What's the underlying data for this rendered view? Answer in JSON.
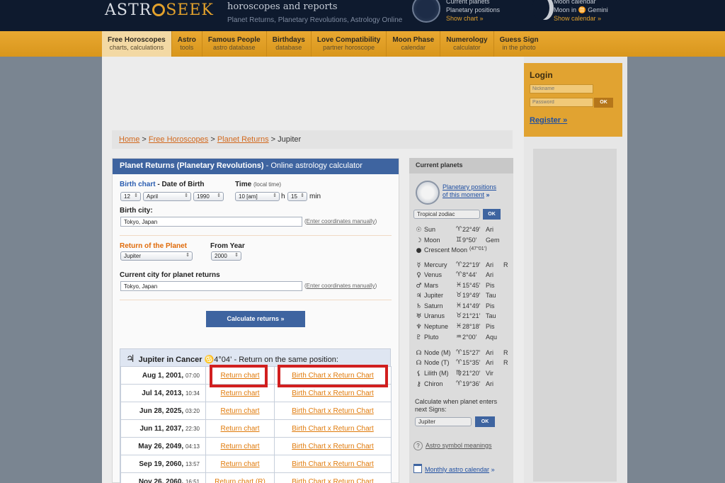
{
  "header": {
    "logo_left": "ASTR",
    "logo_right": "SEEK",
    "title": "horoscopes and reports",
    "subtitle": "Planet Returns, Planetary Revolutions, Astrology Online",
    "planets_title": "Current planets",
    "planets_sub": "Planetary positions",
    "planets_link": "Show chart »",
    "moon_title": "Moon calendar",
    "moon_sub": "Moon in ♊ Gemini",
    "moon_link": "Show calendar »"
  },
  "nav": [
    {
      "title": "Free Horoscopes",
      "sub": "charts, calculations"
    },
    {
      "title": "Astro",
      "sub": "tools"
    },
    {
      "title": "Famous People",
      "sub": "astro database"
    },
    {
      "title": "Birthdays",
      "sub": "database"
    },
    {
      "title": "Love Compatibility",
      "sub": "partner horoscope"
    },
    {
      "title": "Moon Phase",
      "sub": "calendar"
    },
    {
      "title": "Numerology",
      "sub": "calculator"
    },
    {
      "title": "Guess Sign",
      "sub": "in the photo"
    }
  ],
  "breadcrumb": {
    "home": "Home",
    "sep": ">",
    "free": "Free Horoscopes",
    "returns": "Planet Returns",
    "current": "Jupiter"
  },
  "login": {
    "title": "Login",
    "nickname_placeholder": "Nickname",
    "password_placeholder": "Password",
    "ok": "OK",
    "register": "Register »"
  },
  "form": {
    "header_bold": "Planet Returns (Planetary Revolutions)",
    "header_rest": "- Online astrology calculator",
    "birth_chart": "Birth chart",
    "date_of_birth": "- Date of Birth",
    "day": "12",
    "month": "April",
    "year": "1990",
    "time_label": "Time",
    "time_note": "(local time)",
    "hour": "10 [am]",
    "h": "h",
    "minute": "15",
    "min": "min",
    "birth_city_label": "Birth city:",
    "birth_city": "Tokyo, Japan",
    "enter_coords": "Enter coordinates manually",
    "return_planet_label": "Return of the Planet",
    "planet": "Jupiter",
    "from_year_label": "From Year",
    "from_year": "2000",
    "current_city_label": "Current city for planet returns",
    "current_city": "Tokyo, Japan",
    "calc_button": "Calculate returns »"
  },
  "results": {
    "glyph": "♃",
    "title": "Jupiter in Cancer",
    "sign_glyph": "♋",
    "degree": "4°04’",
    "note": "- Return on the same position:",
    "rows": [
      {
        "date": "Aug 1, 2001,",
        "time": "07:00",
        "rc": "Return chart",
        "bc": "Birth Chart x Return Chart"
      },
      {
        "date": "Jul 14, 2013,",
        "time": "10:34",
        "rc": "Return chart",
        "bc": "Birth Chart x Return Chart"
      },
      {
        "date": "Jun 28, 2025,",
        "time": "03:20",
        "rc": "Return chart",
        "bc": "Birth Chart x Return Chart"
      },
      {
        "date": "Jun 11, 2037,",
        "time": "22:30",
        "rc": "Return chart",
        "bc": "Birth Chart x Return Chart"
      },
      {
        "date": "May 26, 2049,",
        "time": "04:13",
        "rc": "Return chart",
        "bc": "Birth Chart x Return Chart"
      },
      {
        "date": "Sep 19, 2060,",
        "time": "13:57",
        "rc": "Return chart",
        "bc": "Birth Chart x Return Chart"
      },
      {
        "date": "Nov 26, 2060,",
        "time": "16:51",
        "rc": "Return chart (R)",
        "bc": "Birth Chart x Return Chart"
      }
    ]
  },
  "current_planets": {
    "title": "Current planets",
    "link": "Planetary positions",
    "link2": "of this moment",
    "link_arrow": "»",
    "zodiac": "Tropical zodiac",
    "ok": "OK",
    "planets": [
      {
        "icon": "☉",
        "name": "Sun",
        "sign": "♈",
        "deg": "22°49’",
        "zs": "Ari",
        "r": ""
      },
      {
        "icon": "☽",
        "name": "Moon",
        "sign": "♊",
        "deg": "9°50’",
        "zs": "Gem",
        "r": ""
      },
      {
        "icon": "●",
        "name": "Crescent Moon",
        "sign": "",
        "deg": "(47°01’)",
        "zs": "",
        "r": ""
      },
      {
        "icon": "☿",
        "name": "Mercury",
        "sign": "♈",
        "deg": "22°19’",
        "zs": "Ari",
        "r": "R"
      },
      {
        "icon": "♀",
        "name": "Venus",
        "sign": "♈",
        "deg": "8°44’",
        "zs": "Ari",
        "r": ""
      },
      {
        "icon": "♂",
        "name": "Mars",
        "sign": "♓",
        "deg": "15°45’",
        "zs": "Pis",
        "r": ""
      },
      {
        "icon": "♃",
        "name": "Jupiter",
        "sign": "♉",
        "deg": "19°49’",
        "zs": "Tau",
        "r": ""
      },
      {
        "icon": "♄",
        "name": "Saturn",
        "sign": "♓",
        "deg": "14°49’",
        "zs": "Pis",
        "r": ""
      },
      {
        "icon": "♅",
        "name": "Uranus",
        "sign": "♉",
        "deg": "21°21’",
        "zs": "Tau",
        "r": ""
      },
      {
        "icon": "♆",
        "name": "Neptune",
        "sign": "♓",
        "deg": "28°18’",
        "zs": "Pis",
        "r": ""
      },
      {
        "icon": "♇",
        "name": "Pluto",
        "sign": "♒",
        "deg": "2°00’",
        "zs": "Aqu",
        "r": ""
      },
      {
        "icon": "☊",
        "name": "Node (M)",
        "sign": "♈",
        "deg": "15°27’",
        "zs": "Ari",
        "r": "R"
      },
      {
        "icon": "☊",
        "name": "Node (T)",
        "sign": "♈",
        "deg": "15°35’",
        "zs": "Ari",
        "r": "R"
      },
      {
        "icon": "⚸",
        "name": "Lilith (M)",
        "sign": "♍",
        "deg": "21°20’",
        "zs": "Vir",
        "r": ""
      },
      {
        "icon": "⚷",
        "name": "Chiron",
        "sign": "♈",
        "deg": "19°36’",
        "zs": "Ari",
        "r": ""
      }
    ],
    "next_signs_note": "Calculate when planet enters next Signs:",
    "next_planet": "Jupiter",
    "next_ok": "OK",
    "symbols_link": "Astro symbol meanings",
    "calendar_link": "Monthly astro calendar",
    "calendar_arrow": "»"
  },
  "colors": {
    "accent_orange": "#e2a12c",
    "nav_blue": "#3e64a0",
    "highlight_red": "#d11f1f",
    "link_orange": "#e07a0a"
  }
}
